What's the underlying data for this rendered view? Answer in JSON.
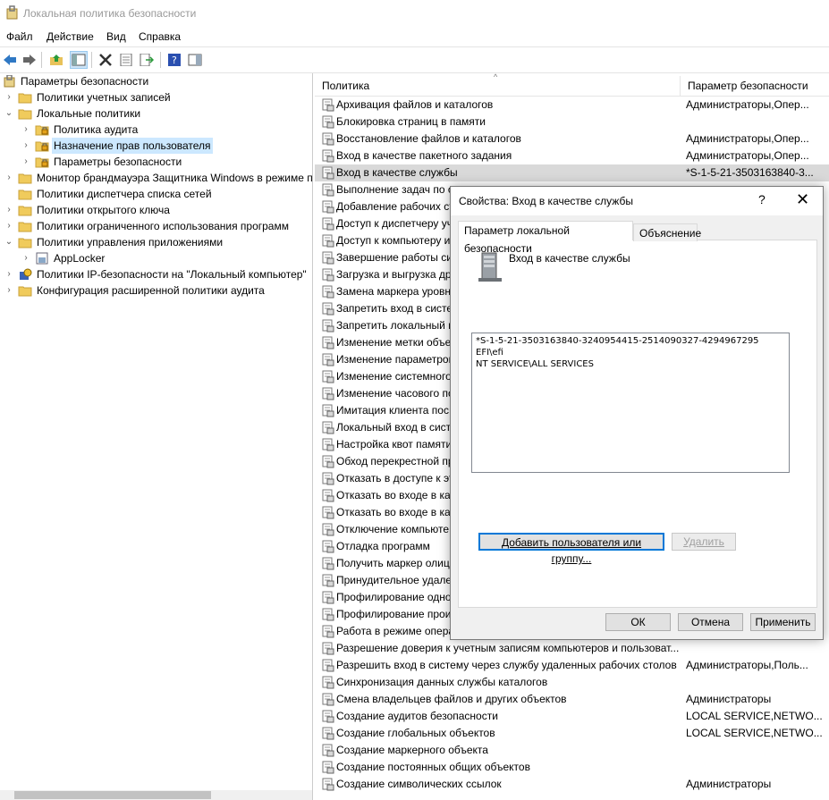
{
  "window": {
    "title": "Локальная политика безопасности"
  },
  "menu": [
    "Файл",
    "Действие",
    "Вид",
    "Справка"
  ],
  "tree": {
    "root": "Параметры безопасности",
    "items": [
      {
        "label": "Политики учетных записей",
        "level": 1,
        "expanded": false,
        "icon": "folder-icon"
      },
      {
        "label": "Локальные политики",
        "level": 1,
        "expanded": true,
        "icon": "folder-icon"
      },
      {
        "label": "Политика аудита",
        "level": 2,
        "expanded": false,
        "icon": "folder-lock-icon"
      },
      {
        "label": "Назначение прав пользователя",
        "level": 2,
        "expanded": false,
        "icon": "folder-lock-icon",
        "selected": true
      },
      {
        "label": "Параметры безопасности",
        "level": 2,
        "expanded": false,
        "icon": "folder-lock-icon"
      },
      {
        "label": "Монитор брандмауэра Защитника Windows в режиме повышенной безопасности",
        "level": 1,
        "expanded": false,
        "icon": "folder-icon"
      },
      {
        "label": "Политики диспетчера списка сетей",
        "level": 1,
        "expanded": null,
        "icon": "folder-icon"
      },
      {
        "label": "Политики открытого ключа",
        "level": 1,
        "expanded": false,
        "icon": "folder-icon"
      },
      {
        "label": "Политики ограниченного использования программ",
        "level": 1,
        "expanded": false,
        "icon": "folder-icon"
      },
      {
        "label": "Политики управления приложениями",
        "level": 1,
        "expanded": true,
        "icon": "folder-icon"
      },
      {
        "label": "AppLocker",
        "level": 2,
        "expanded": false,
        "icon": "applocker-icon"
      },
      {
        "label": "Политики IP-безопасности на \"Локальный компьютер\"",
        "level": 1,
        "expanded": false,
        "icon": "ipsec-icon"
      },
      {
        "label": "Конфигурация расширенной политики аудита",
        "level": 1,
        "expanded": false,
        "icon": "folder-icon"
      }
    ]
  },
  "list": {
    "columns": [
      "Политика",
      "Параметр безопасности"
    ],
    "rows": [
      [
        "Архивация файлов и каталогов",
        "Администраторы,Опер..."
      ],
      [
        "Блокировка страниц в памяти",
        ""
      ],
      [
        "Восстановление файлов и каталогов",
        "Администраторы,Опер..."
      ],
      [
        "Вход в качестве пакетного задания",
        "Администраторы,Опер..."
      ],
      [
        "Вход в качестве службы",
        "*S-1-5-21-3503163840-3..."
      ],
      [
        "Выполнение задач по о",
        ""
      ],
      [
        "Добавление рабочих ст",
        ""
      ],
      [
        "Доступ к диспетчеру уч",
        ""
      ],
      [
        "Доступ к компьютеру и",
        ""
      ],
      [
        "Завершение работы сис",
        ""
      ],
      [
        "Загрузка и выгрузка др",
        ""
      ],
      [
        "Замена маркера уровня",
        ""
      ],
      [
        "Запретить вход в систе",
        ""
      ],
      [
        "Запретить локальный в",
        ""
      ],
      [
        "Изменение метки объе",
        ""
      ],
      [
        "Изменение параметров",
        ""
      ],
      [
        "Изменение системного",
        ""
      ],
      [
        "Изменение часового по",
        ""
      ],
      [
        "Имитация клиента пос",
        ""
      ],
      [
        "Локальный вход в сист",
        ""
      ],
      [
        "Настройка квот памяти",
        ""
      ],
      [
        "Обход перекрестной пр",
        ""
      ],
      [
        "Отказать в доступе к эт",
        ""
      ],
      [
        "Отказать во входе в кач",
        ""
      ],
      [
        "Отказать во входе в кач",
        ""
      ],
      [
        "Отключение компьюте",
        ""
      ],
      [
        "Отладка программ",
        ""
      ],
      [
        "Получить маркер олиц",
        ""
      ],
      [
        "Принудительное удале",
        ""
      ],
      [
        "Профилирование одно",
        ""
      ],
      [
        "Профилирование прои",
        ""
      ],
      [
        "Работа в режиме опера",
        ""
      ],
      [
        "Разрешение доверия к учетным записям компьютеров и пользоват...",
        ""
      ],
      [
        "Разрешить вход в систему через службу удаленных рабочих столов",
        "Администраторы,Поль..."
      ],
      [
        "Синхронизация данных службы каталогов",
        ""
      ],
      [
        "Смена владельцев файлов и других объектов",
        "Администраторы"
      ],
      [
        "Создание аудитов безопасности",
        "LOCAL SERVICE,NETWO..."
      ],
      [
        "Создание глобальных объектов",
        "LOCAL SERVICE,NETWO..."
      ],
      [
        "Создание маркерного объекта",
        ""
      ],
      [
        "Создание постоянных общих объектов",
        ""
      ],
      [
        "Создание символических ссылок",
        "Администраторы"
      ]
    ]
  },
  "dialog": {
    "title": "Свойства: Вход в качестве службы",
    "help": "?",
    "tabs": [
      "Параметр локальной безопасности",
      "Объяснение"
    ],
    "policy_name": "Вход в качестве службы",
    "accounts": [
      "*S-1-5-21-3503163840-3240954415-2514090327-4294967295",
      "EFI\\efi",
      "NT SERVICE\\ALL SERVICES"
    ],
    "add_button": "Добавить пользователя или группу...",
    "remove_button": "Удалить",
    "ok": "ОК",
    "cancel": "Отмена",
    "apply": "Применить"
  }
}
